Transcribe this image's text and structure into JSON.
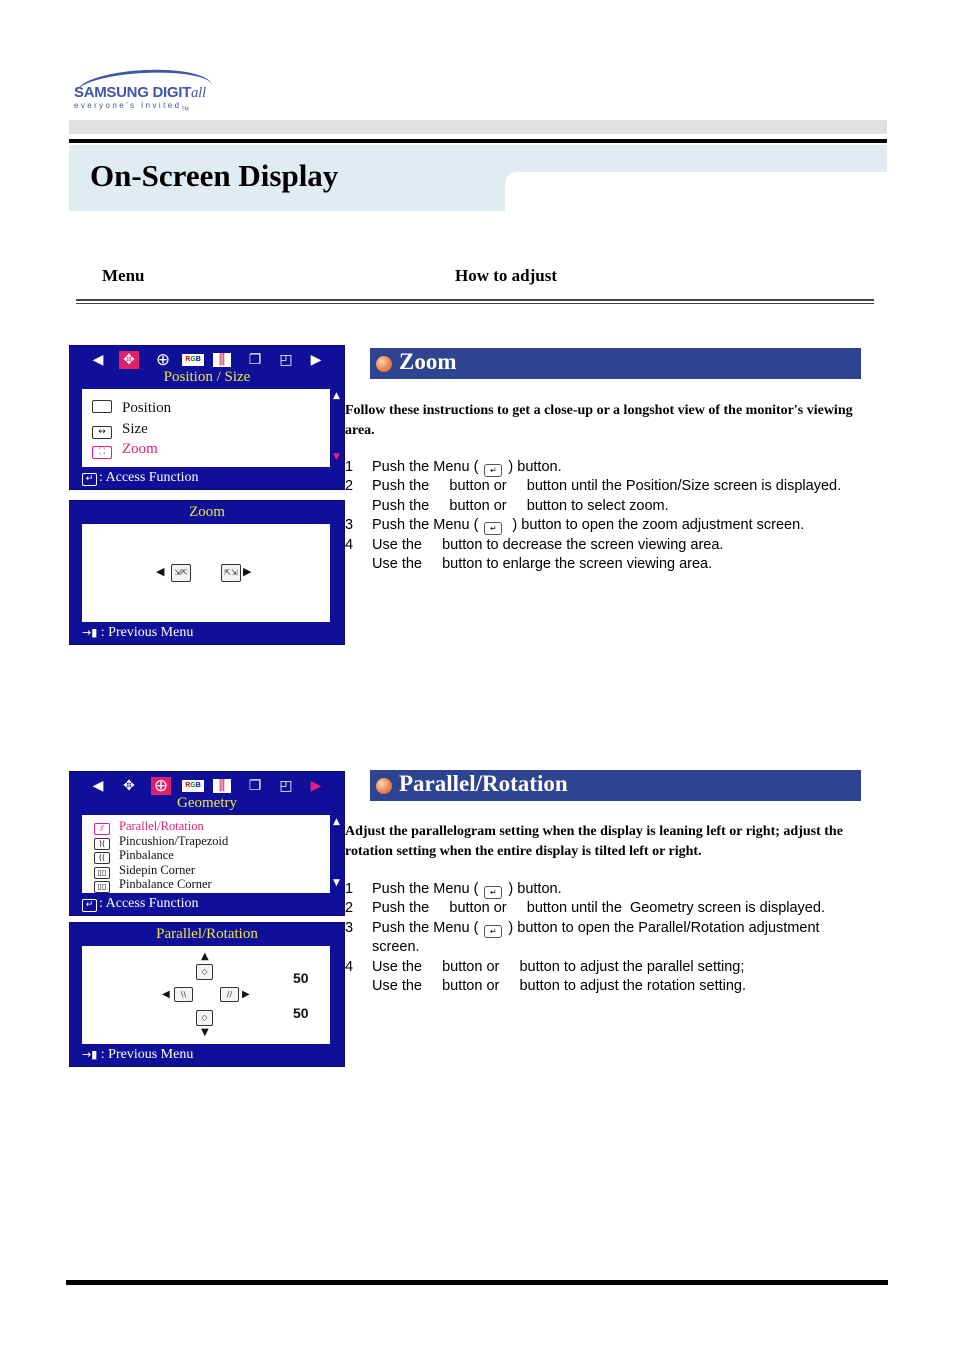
{
  "logo": {
    "brand": "SAMSUNG DIGIT",
    "brand_script": "all",
    "tagline": "everyone's Invited",
    "tm": "TM"
  },
  "page_title": "On-Screen Display",
  "columns": {
    "menu": "Menu",
    "how_to_adjust": "How to adjust"
  },
  "icons": {
    "arrow_left": "◀",
    "arrow_right": "▶",
    "arrow_up": "▲",
    "arrow_down": "▼",
    "enter": "↵",
    "exit": "→▮",
    "position_tab": "✥",
    "geometry_tab": "⊕",
    "color_tab": "RGB",
    "eq_tab": "⫼",
    "copy_tab": "❐",
    "window_tab": "◰"
  },
  "colors": {
    "osd_blue": "#0f0f9a",
    "highlight_pink": "#e0207a",
    "osd_title_yellow": "#f0e640",
    "section_blue": "#2e4491"
  },
  "sections": [
    {
      "heading": "Zoom",
      "osd_menu": {
        "title": "Position / Size",
        "selected_tab": "position",
        "items": [
          {
            "label": "Position",
            "icon": "position-icon",
            "selected": false
          },
          {
            "label": "Size",
            "icon": "size-icon",
            "selected": false
          },
          {
            "label": "Zoom",
            "icon": "zoom-icon",
            "selected": true
          }
        ],
        "footer": ": Access Function"
      },
      "osd_adjust": {
        "title": "Zoom",
        "footer": ": Previous Menu"
      },
      "intro": "Follow these instructions to get a close-up or a longshot view of the monitor's viewing area.",
      "steps": [
        {
          "num": "1",
          "pre": "Push the Menu (",
          "post": ") button.",
          "has_key": true
        },
        {
          "num": "2",
          "text": "Push the     button or     button until the Position/Size screen is displayed."
        },
        {
          "num": "",
          "text": "Push the     button or     button to select zoom."
        },
        {
          "num": "3",
          "pre": "Push the Menu (",
          "post": " ) button to open the zoom adjustment screen.",
          "has_key": true
        },
        {
          "num": "4",
          "text": "Use the     button to decrease the screen viewing area."
        },
        {
          "num": "",
          "text": "Use the     button to enlarge the screen viewing area."
        }
      ]
    },
    {
      "heading": "Parallel/Rotation",
      "osd_menu": {
        "title": "Geometry",
        "selected_tab": "geometry",
        "items": [
          {
            "label": "Parallel/Rotation",
            "icon": "parallel-icon",
            "selected": true
          },
          {
            "label": "Pincushion/Trapezoid",
            "icon": "pincushion-icon",
            "selected": false
          },
          {
            "label": "Pinbalance",
            "icon": "pinbalance-icon",
            "selected": false
          },
          {
            "label": "Sidepin Corner",
            "icon": "sidepin-icon",
            "selected": false
          },
          {
            "label": "Pinbalance Corner",
            "icon": "pinbalance-corner-icon",
            "selected": false
          }
        ],
        "footer": ": Access Function"
      },
      "osd_adjust": {
        "title": "Parallel/Rotation",
        "parallel_value": "50",
        "rotation_value": "50",
        "footer": ": Previous Menu"
      },
      "intro": "Adjust the parallelogram setting when the display is leaning left or right; adjust the rotation setting when the entire display is tilted left or right.",
      "steps": [
        {
          "num": "1",
          "pre": "Push the Menu (",
          "post": ") button.",
          "has_key": true
        },
        {
          "num": "2",
          "text": "Push the     button or     button until the  Geometry screen is displayed."
        },
        {
          "num": "3",
          "pre": "Push the Menu (",
          "post": ") button to open the Parallel/Rotation adjustment",
          "has_key": true
        },
        {
          "num": "",
          "text": "screen."
        },
        {
          "num": "4",
          "text": "Use the     button or     button to adjust the parallel setting;"
        },
        {
          "num": "",
          "text": "Use the     button or     button to adjust the rotation setting."
        }
      ]
    }
  ]
}
